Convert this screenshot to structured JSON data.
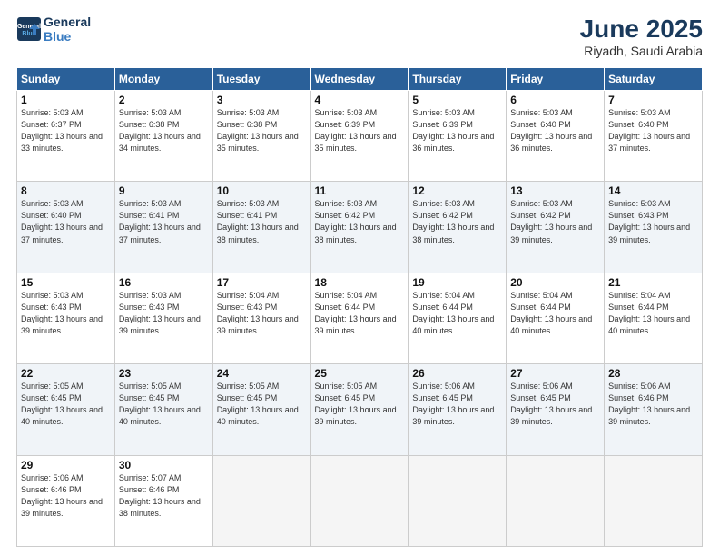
{
  "logo": {
    "line1": "General",
    "line2": "Blue"
  },
  "title": "June 2025",
  "subtitle": "Riyadh, Saudi Arabia",
  "weekdays": [
    "Sunday",
    "Monday",
    "Tuesday",
    "Wednesday",
    "Thursday",
    "Friday",
    "Saturday"
  ],
  "weeks": [
    [
      {
        "day": "1",
        "sunrise": "Sunrise: 5:03 AM",
        "sunset": "Sunset: 6:37 PM",
        "daylight": "Daylight: 13 hours and 33 minutes."
      },
      {
        "day": "2",
        "sunrise": "Sunrise: 5:03 AM",
        "sunset": "Sunset: 6:38 PM",
        "daylight": "Daylight: 13 hours and 34 minutes."
      },
      {
        "day": "3",
        "sunrise": "Sunrise: 5:03 AM",
        "sunset": "Sunset: 6:38 PM",
        "daylight": "Daylight: 13 hours and 35 minutes."
      },
      {
        "day": "4",
        "sunrise": "Sunrise: 5:03 AM",
        "sunset": "Sunset: 6:39 PM",
        "daylight": "Daylight: 13 hours and 35 minutes."
      },
      {
        "day": "5",
        "sunrise": "Sunrise: 5:03 AM",
        "sunset": "Sunset: 6:39 PM",
        "daylight": "Daylight: 13 hours and 36 minutes."
      },
      {
        "day": "6",
        "sunrise": "Sunrise: 5:03 AM",
        "sunset": "Sunset: 6:40 PM",
        "daylight": "Daylight: 13 hours and 36 minutes."
      },
      {
        "day": "7",
        "sunrise": "Sunrise: 5:03 AM",
        "sunset": "Sunset: 6:40 PM",
        "daylight": "Daylight: 13 hours and 37 minutes."
      }
    ],
    [
      {
        "day": "8",
        "sunrise": "Sunrise: 5:03 AM",
        "sunset": "Sunset: 6:40 PM",
        "daylight": "Daylight: 13 hours and 37 minutes."
      },
      {
        "day": "9",
        "sunrise": "Sunrise: 5:03 AM",
        "sunset": "Sunset: 6:41 PM",
        "daylight": "Daylight: 13 hours and 37 minutes."
      },
      {
        "day": "10",
        "sunrise": "Sunrise: 5:03 AM",
        "sunset": "Sunset: 6:41 PM",
        "daylight": "Daylight: 13 hours and 38 minutes."
      },
      {
        "day": "11",
        "sunrise": "Sunrise: 5:03 AM",
        "sunset": "Sunset: 6:42 PM",
        "daylight": "Daylight: 13 hours and 38 minutes."
      },
      {
        "day": "12",
        "sunrise": "Sunrise: 5:03 AM",
        "sunset": "Sunset: 6:42 PM",
        "daylight": "Daylight: 13 hours and 38 minutes."
      },
      {
        "day": "13",
        "sunrise": "Sunrise: 5:03 AM",
        "sunset": "Sunset: 6:42 PM",
        "daylight": "Daylight: 13 hours and 39 minutes."
      },
      {
        "day": "14",
        "sunrise": "Sunrise: 5:03 AM",
        "sunset": "Sunset: 6:43 PM",
        "daylight": "Daylight: 13 hours and 39 minutes."
      }
    ],
    [
      {
        "day": "15",
        "sunrise": "Sunrise: 5:03 AM",
        "sunset": "Sunset: 6:43 PM",
        "daylight": "Daylight: 13 hours and 39 minutes."
      },
      {
        "day": "16",
        "sunrise": "Sunrise: 5:03 AM",
        "sunset": "Sunset: 6:43 PM",
        "daylight": "Daylight: 13 hours and 39 minutes."
      },
      {
        "day": "17",
        "sunrise": "Sunrise: 5:04 AM",
        "sunset": "Sunset: 6:43 PM",
        "daylight": "Daylight: 13 hours and 39 minutes."
      },
      {
        "day": "18",
        "sunrise": "Sunrise: 5:04 AM",
        "sunset": "Sunset: 6:44 PM",
        "daylight": "Daylight: 13 hours and 39 minutes."
      },
      {
        "day": "19",
        "sunrise": "Sunrise: 5:04 AM",
        "sunset": "Sunset: 6:44 PM",
        "daylight": "Daylight: 13 hours and 40 minutes."
      },
      {
        "day": "20",
        "sunrise": "Sunrise: 5:04 AM",
        "sunset": "Sunset: 6:44 PM",
        "daylight": "Daylight: 13 hours and 40 minutes."
      },
      {
        "day": "21",
        "sunrise": "Sunrise: 5:04 AM",
        "sunset": "Sunset: 6:44 PM",
        "daylight": "Daylight: 13 hours and 40 minutes."
      }
    ],
    [
      {
        "day": "22",
        "sunrise": "Sunrise: 5:05 AM",
        "sunset": "Sunset: 6:45 PM",
        "daylight": "Daylight: 13 hours and 40 minutes."
      },
      {
        "day": "23",
        "sunrise": "Sunrise: 5:05 AM",
        "sunset": "Sunset: 6:45 PM",
        "daylight": "Daylight: 13 hours and 40 minutes."
      },
      {
        "day": "24",
        "sunrise": "Sunrise: 5:05 AM",
        "sunset": "Sunset: 6:45 PM",
        "daylight": "Daylight: 13 hours and 40 minutes."
      },
      {
        "day": "25",
        "sunrise": "Sunrise: 5:05 AM",
        "sunset": "Sunset: 6:45 PM",
        "daylight": "Daylight: 13 hours and 39 minutes."
      },
      {
        "day": "26",
        "sunrise": "Sunrise: 5:06 AM",
        "sunset": "Sunset: 6:45 PM",
        "daylight": "Daylight: 13 hours and 39 minutes."
      },
      {
        "day": "27",
        "sunrise": "Sunrise: 5:06 AM",
        "sunset": "Sunset: 6:45 PM",
        "daylight": "Daylight: 13 hours and 39 minutes."
      },
      {
        "day": "28",
        "sunrise": "Sunrise: 5:06 AM",
        "sunset": "Sunset: 6:46 PM",
        "daylight": "Daylight: 13 hours and 39 minutes."
      }
    ],
    [
      {
        "day": "29",
        "sunrise": "Sunrise: 5:06 AM",
        "sunset": "Sunset: 6:46 PM",
        "daylight": "Daylight: 13 hours and 39 minutes."
      },
      {
        "day": "30",
        "sunrise": "Sunrise: 5:07 AM",
        "sunset": "Sunset: 6:46 PM",
        "daylight": "Daylight: 13 hours and 38 minutes."
      },
      null,
      null,
      null,
      null,
      null
    ]
  ]
}
